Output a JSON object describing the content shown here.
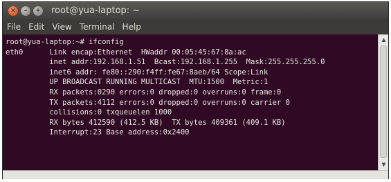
{
  "window": {
    "title": "root@yua-laptop: ~",
    "buttons": [
      "close",
      "minimize",
      "maximize"
    ]
  },
  "menu": {
    "items": [
      "File",
      "Edit",
      "View",
      "Terminal",
      "Help"
    ]
  },
  "terminal": {
    "background": "#300a24",
    "foreground": "#e9e9e3",
    "lines": [
      "root@yua-laptop:~# ifconfig",
      "eth0      Link encap:Ethernet  HWaddr 00:05:45:67:8a:ac",
      "          inet addr:192.168.1.51  Bcast:192.168.1.255  Mask:255.255.255.0",
      "          inet6 addr: fe80::290:f4ff:fe67:8aeb/64 Scope:Link",
      "          UP BROADCAST RUNNING MULTICAST  MTU:1500  Metric:1",
      "          RX packets:0290 errors:0 dropped:0 overruns:0 frame:0",
      "          TX packets:4112 errors:0 dropped:0 overruns:0 carrier 0",
      "          collisions:0 txqueuelen 1000",
      "          RX bytes 412590 (412.5 KB)  TX bytes 409361 (409.1 KB)",
      "          Interrupt:23 Base address:0x2400",
      "",
      "",
      ""
    ]
  }
}
